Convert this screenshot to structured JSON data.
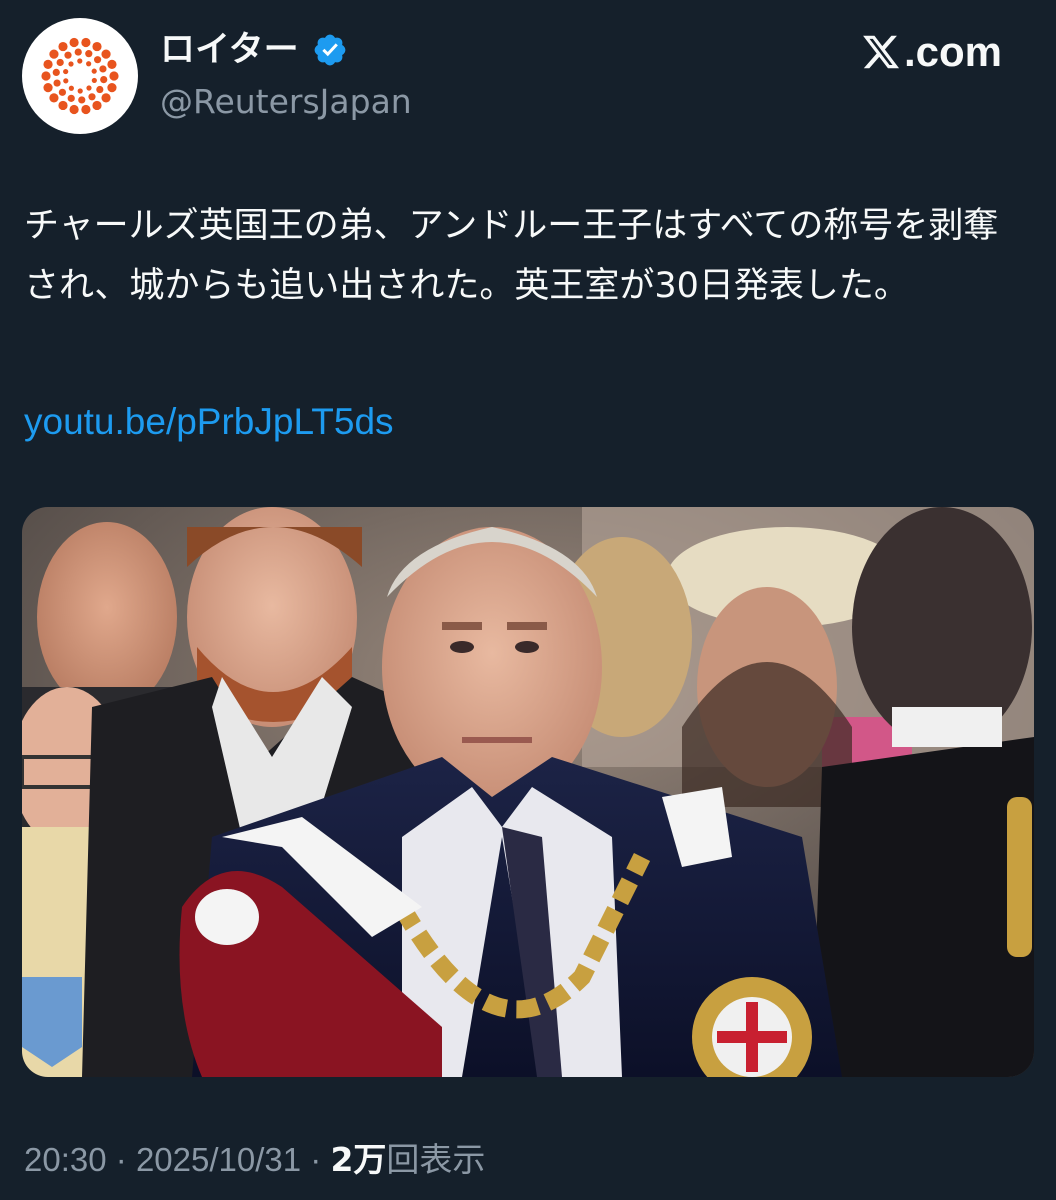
{
  "account": {
    "display_name": "ロイター",
    "handle": "@ReutersJapan",
    "verified": true,
    "avatar_icon": "reuters-logo-icon"
  },
  "watermark": {
    "label": ".com",
    "icon": "x-logo-icon"
  },
  "tweet": {
    "text": "チャールズ英国王の弟、アンドルー王子はすべての称号を剥奪され、城からも追い出された。英王室が30日発表した。",
    "link": "youtu.be/pPrbJpLT5ds"
  },
  "media": {
    "type": "photo",
    "icon": "photo-image"
  },
  "meta": {
    "time": "20:30",
    "separator": "·",
    "date": "2025/10/31",
    "views_count": "2万",
    "views_label": "回表示"
  },
  "colors": {
    "background": "#15202b",
    "text_primary": "#f7f9f9",
    "text_secondary": "#8b98a5",
    "link": "#1d9bf0",
    "verified_badge": "#1d9bf0",
    "reuters_orange": "#e8541e"
  }
}
